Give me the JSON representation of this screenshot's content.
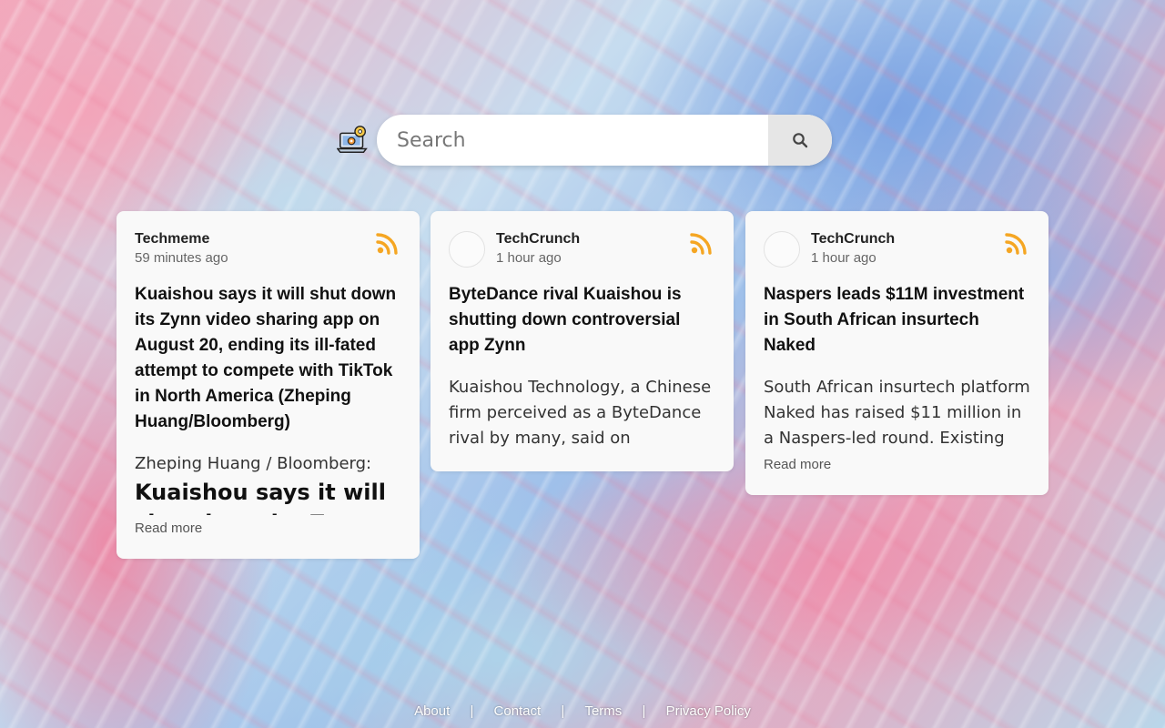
{
  "search": {
    "placeholder": "Search",
    "value": ""
  },
  "icons": {
    "logo": "laptop-gears-icon",
    "search": "search-icon",
    "feed": "rss-icon"
  },
  "colors": {
    "rss": "#f5a623",
    "card_bg": "#f9f9f9"
  },
  "cards": [
    {
      "source": "Techmeme",
      "time": "59 minutes ago",
      "title": "Kuaishou says it will shut down its Zynn video sharing app on August 20, ending its ill-fated attempt to compete with TikTok in North America (Zheping Huang/Bloomberg)",
      "summary_lead": "Zheping Huang / Bloomberg:",
      "summary_big": "Kuaishou says it will shut down its Zynn video",
      "read_more": "Read more"
    },
    {
      "source": "TechCrunch",
      "time": "1 hour ago",
      "title": "ByteDance rival Kuaishou is shutting down controversial app Zynn",
      "summary": "Kuaishou Technology, a Chinese firm perceived as a ByteDance rival by many, said on Wednesday"
    },
    {
      "source": "TechCrunch",
      "time": "1 hour ago",
      "title": "Naspers leads $11M investment in South African insurtech Naked",
      "summary": "South African insurtech platform Naked has raised $11 million in a Naspers-led round. Existing",
      "read_more": "Read more"
    }
  ],
  "footer": {
    "links": [
      "About",
      "Contact",
      "Terms",
      "Privacy Policy"
    ],
    "separator": "|"
  }
}
